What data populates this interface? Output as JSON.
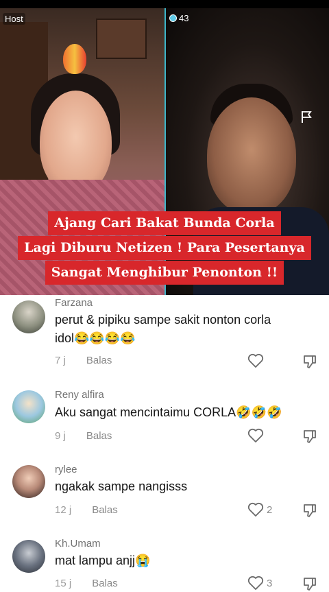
{
  "stream": {
    "host_label": "Host",
    "viewer_count": "43",
    "viewer_icon": "eye-icon",
    "report_icon": "flag-icon"
  },
  "headline": {
    "line1": "Ajang Cari Bakat Bunda Corla",
    "line2": "Lagi Diburu Netizen ! Para Pesertanya",
    "line3": "Sangat Menghibur Penonton !!",
    "bg_color": "#d8272b"
  },
  "comments": [
    {
      "username": "Farzana",
      "text_line1": "perut & pipiku sampe sakit nonton corla",
      "text_line2": "idol😂😂😂😂",
      "time": "7 j",
      "reply_label": "Balas",
      "likes": ""
    },
    {
      "username": "Reny alfira",
      "text_line1": "Aku sangat mencintaimu CORLA🤣🤣🤣",
      "text_line2": "",
      "time": "9 j",
      "reply_label": "Balas",
      "likes": ""
    },
    {
      "username": "rylee",
      "text_line1": "ngakak sampe nangisss",
      "text_line2": "",
      "time": "12 j",
      "reply_label": "Balas",
      "likes": "2"
    },
    {
      "username": "Kh.Umam",
      "text_line1": "mat lampu anjj😭",
      "text_line2": "",
      "time": "15 j",
      "reply_label": "Balas",
      "likes": "3"
    }
  ]
}
